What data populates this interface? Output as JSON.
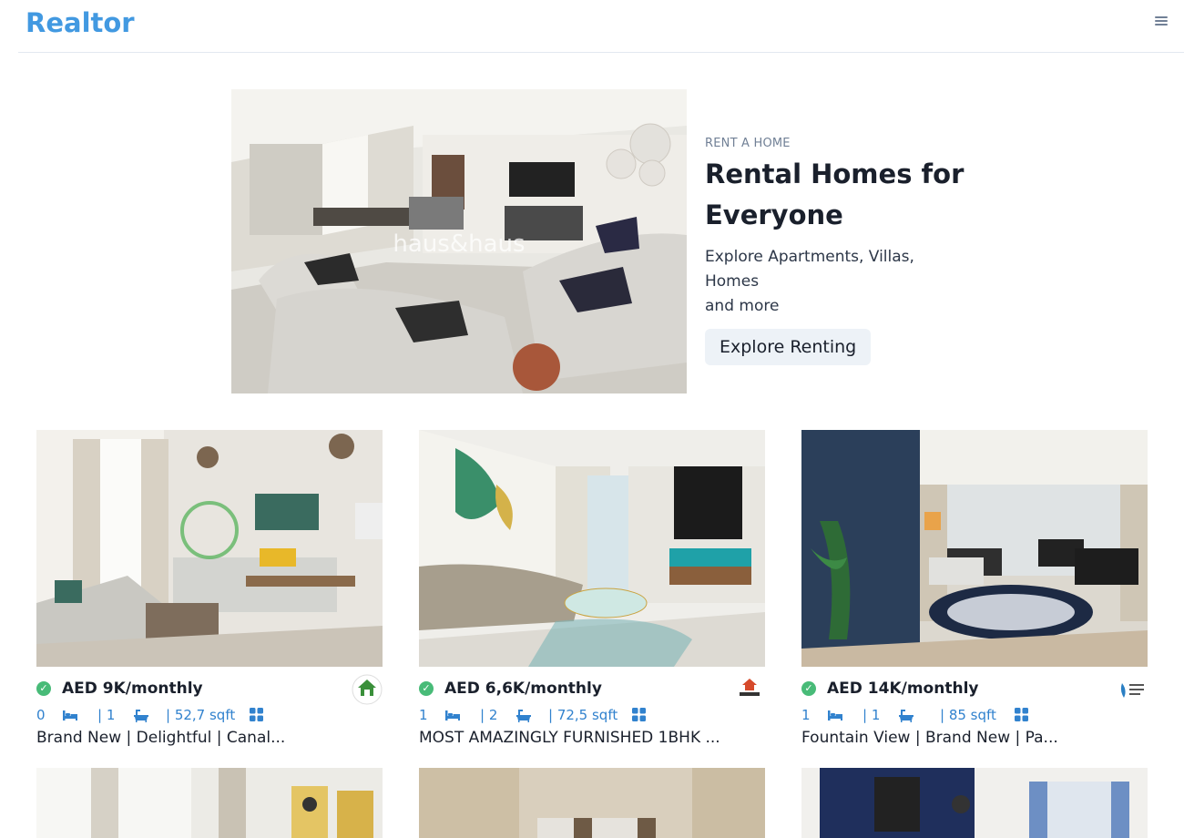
{
  "navbar": {
    "brand": "Realtor",
    "menu_icon": "hamburger-menu-icon"
  },
  "banner": {
    "eyebrow": "RENT A HOME",
    "title_line1": "Rental Homes for",
    "title_line2": "Everyone",
    "desc_line1": "Explore Apartments, Villas, Homes",
    "desc_line2": "and more",
    "button": "Explore Renting",
    "image_watermark": "haus&haus"
  },
  "listings": [
    {
      "price": "AED 9K/monthly",
      "rooms": "0",
      "baths": "| 1",
      "area": "| 52,7 sqft",
      "title": "Brand New | Delightful | Canal...",
      "agency_logo": "green-house-logo",
      "verified": true,
      "accent_color": "#3a6b5f"
    },
    {
      "price": "AED 6,6K/monthly",
      "rooms": "1",
      "baths": "| 2",
      "area": "| 72,5 sqft",
      "title": "MOST AMAZINGLY FURNISHED 1BHK ...",
      "agency_logo": "ace-home-logo",
      "verified": true,
      "accent_color": "#1fa1a8"
    },
    {
      "price": "AED 14K/monthly",
      "rooms": "1",
      "baths": "| 1",
      "area": "| 85 sqft",
      "title": "Fountain View | Brand New | Pa...",
      "agency_logo": "al-sarya-holiday-logo",
      "verified": true,
      "accent_color": "#1d2a44"
    }
  ],
  "colors": {
    "brand": "#4299e1",
    "stats": "#3182ce",
    "verified": "#48bb78",
    "button_bg": "#edf2f7"
  },
  "icons": {
    "verified": "check-circle-icon",
    "bed": "bed-icon",
    "bath": "bathtub-icon",
    "grid": "grid-icon"
  }
}
